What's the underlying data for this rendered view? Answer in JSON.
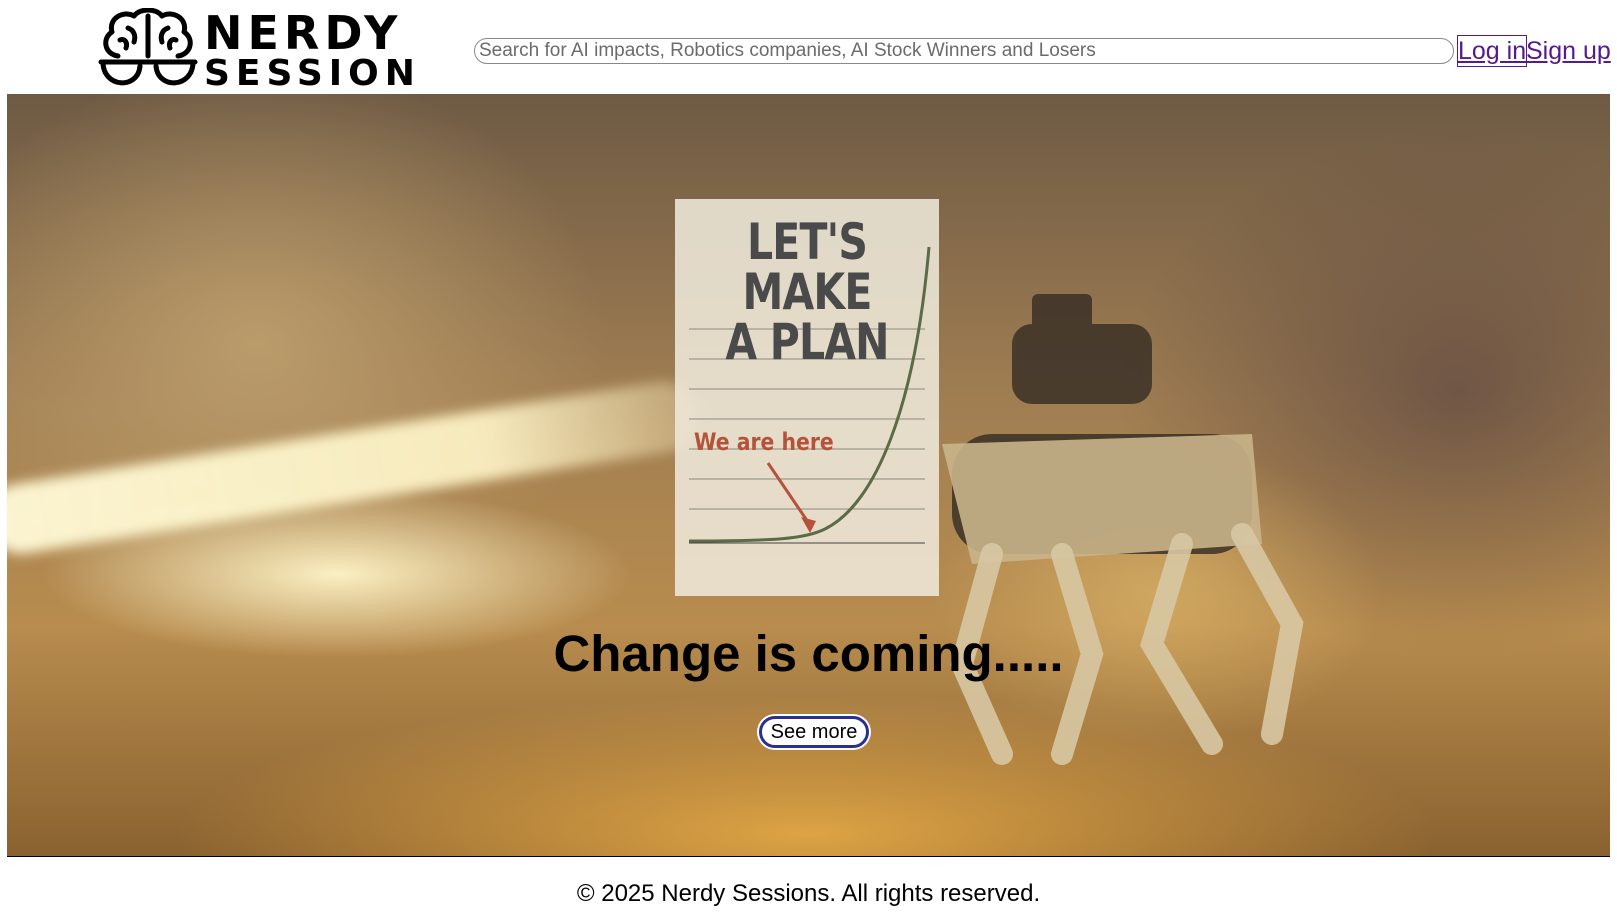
{
  "header": {
    "logo": {
      "line1": "NERDY",
      "line2": "SESSION",
      "icon": "brain-glasses-icon"
    },
    "search": {
      "placeholder": "Search for AI impacts, Robotics companies, AI Stock Winners and Losers",
      "value": ""
    },
    "login_label": "Log in",
    "signup_label": "Sign up"
  },
  "hero": {
    "poster": {
      "title_line1": "LET'S MAKE",
      "title_line2": "A PLAN",
      "label": "We are here"
    },
    "headline": "Change is coming.....",
    "cta_label": "See more"
  },
  "footer": {
    "copyright": "© 2025 Nerdy Sessions. All rights reserved."
  },
  "colors": {
    "link": "#551a8b",
    "cta_border": "#2b2f8f",
    "poster_curve": "#5a6b45",
    "poster_label": "#b5533a"
  }
}
